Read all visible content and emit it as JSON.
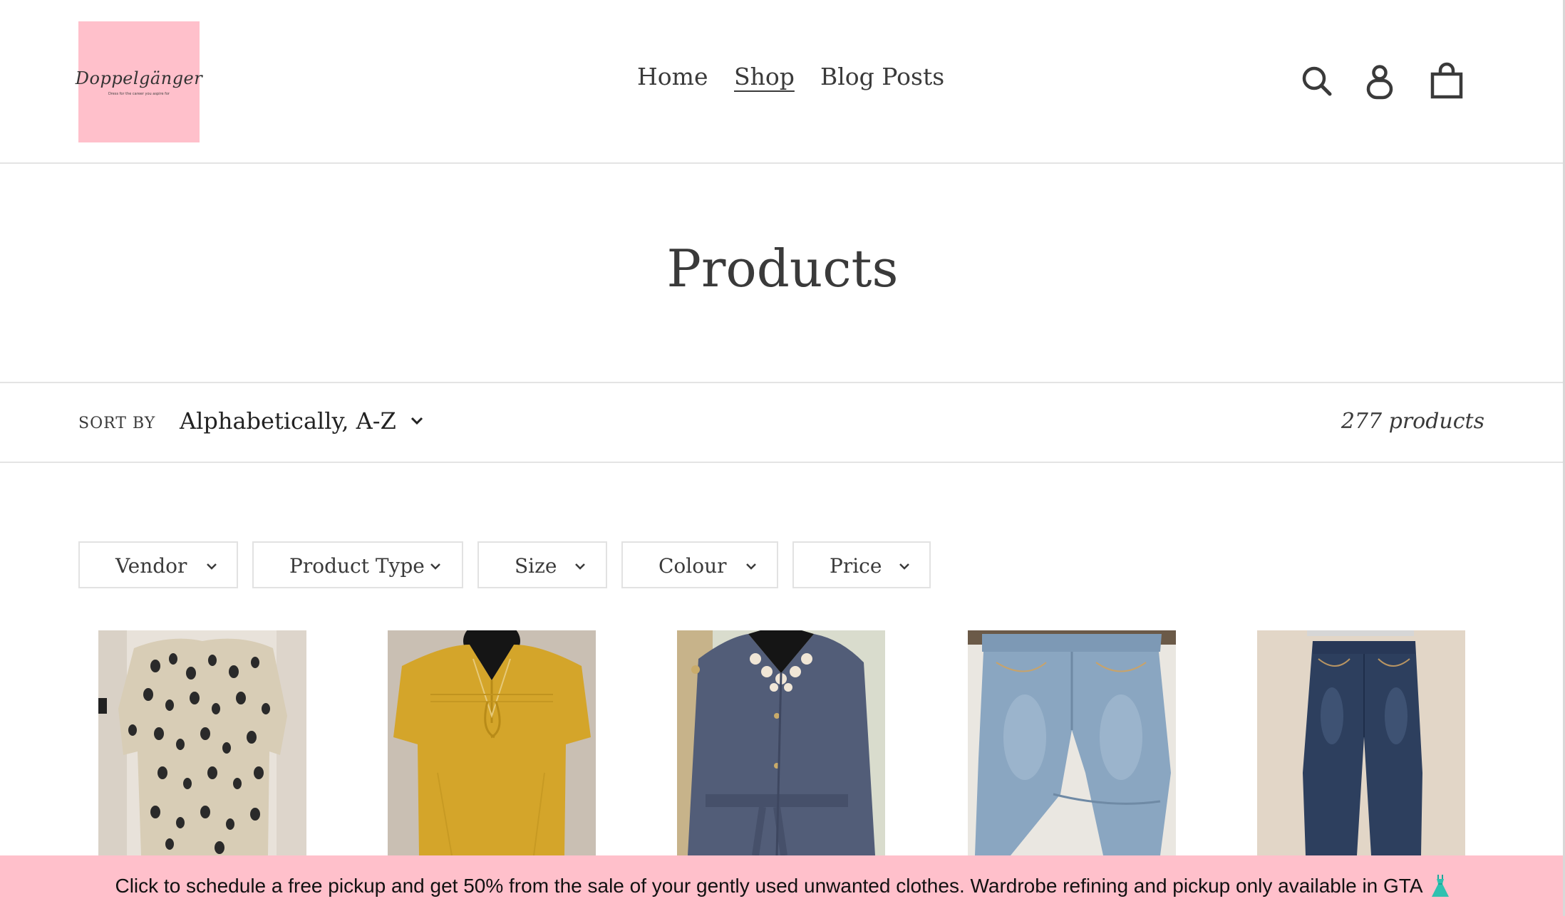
{
  "header": {
    "logo": {
      "name": "Doppelgänger",
      "tagline": "Dress for the career you aspire for"
    },
    "nav": [
      {
        "label": "Home",
        "active": false
      },
      {
        "label": "Shop",
        "active": true
      },
      {
        "label": "Blog Posts",
        "active": false
      }
    ],
    "icons": [
      "search-icon",
      "account-icon",
      "cart-icon"
    ]
  },
  "page": {
    "title": "Products"
  },
  "sort": {
    "label": "SORT BY",
    "selected": "Alphabetically, A-Z",
    "count": "277 products"
  },
  "filters": [
    {
      "label": "Vendor"
    },
    {
      "label": "Product Type"
    },
    {
      "label": "Size"
    },
    {
      "label": "Colour"
    },
    {
      "label": "Price"
    }
  ],
  "products": [
    {
      "image": "leopard-print-blouse"
    },
    {
      "image": "mustard-yellow-top"
    },
    {
      "image": "navy-belted-jacket"
    },
    {
      "image": "light-wash-jeans"
    },
    {
      "image": "dark-wash-jeans"
    }
  ],
  "banner": {
    "text": "Click to schedule a free pickup and get 50% from the sale of your gently used unwanted clothes. Wardrobe refining and pickup only available in GTA",
    "icon": "dress-icon"
  },
  "colors": {
    "brand_pink": "#ffc0cb",
    "text": "#3a3a3a",
    "border": "#e4e4e4"
  }
}
